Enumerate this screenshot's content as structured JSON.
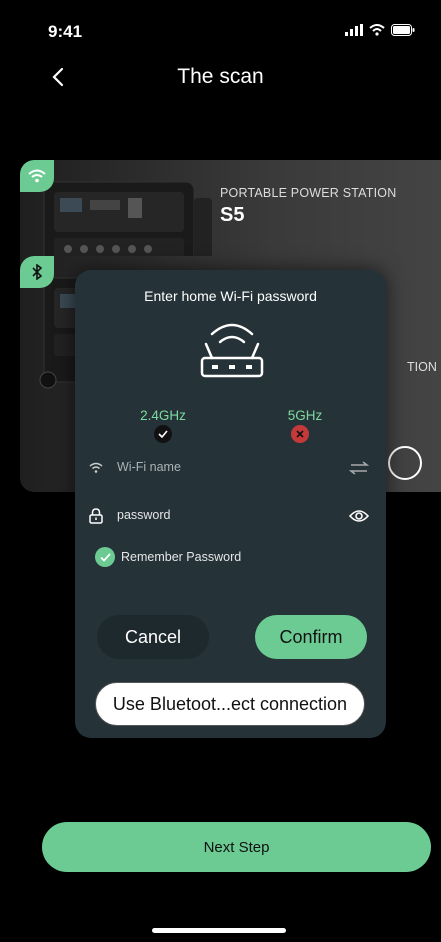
{
  "status_bar": {
    "time": "9:41"
  },
  "header": {
    "title": "The scan"
  },
  "devices": [
    {
      "type": "PORTABLE POWER STATION",
      "model": "S5",
      "connection_icon": "wifi-icon",
      "selected": true
    },
    {
      "type_fragment": "TION",
      "connection_icon": "bluetooth-icon",
      "selected": false
    }
  ],
  "dialog": {
    "title": "Enter home Wi-Fi password",
    "bands": [
      {
        "label": "2.4GHz",
        "status": "supported"
      },
      {
        "label": "5GHz",
        "status": "unsupported"
      }
    ],
    "wifi_name_placeholder": "Wi-Fi name",
    "password_value": "password",
    "remember_label": "Remember Password",
    "remember_checked": true,
    "cancel_label": "Cancel",
    "confirm_label": "Confirm",
    "bluetooth_label": "Use Bluetoot...ect connection"
  },
  "footer": {
    "next_label": "Next Step"
  },
  "colors": {
    "accent": "#6ccb93",
    "dialog_bg": "#253238",
    "error": "#c43a3a"
  }
}
